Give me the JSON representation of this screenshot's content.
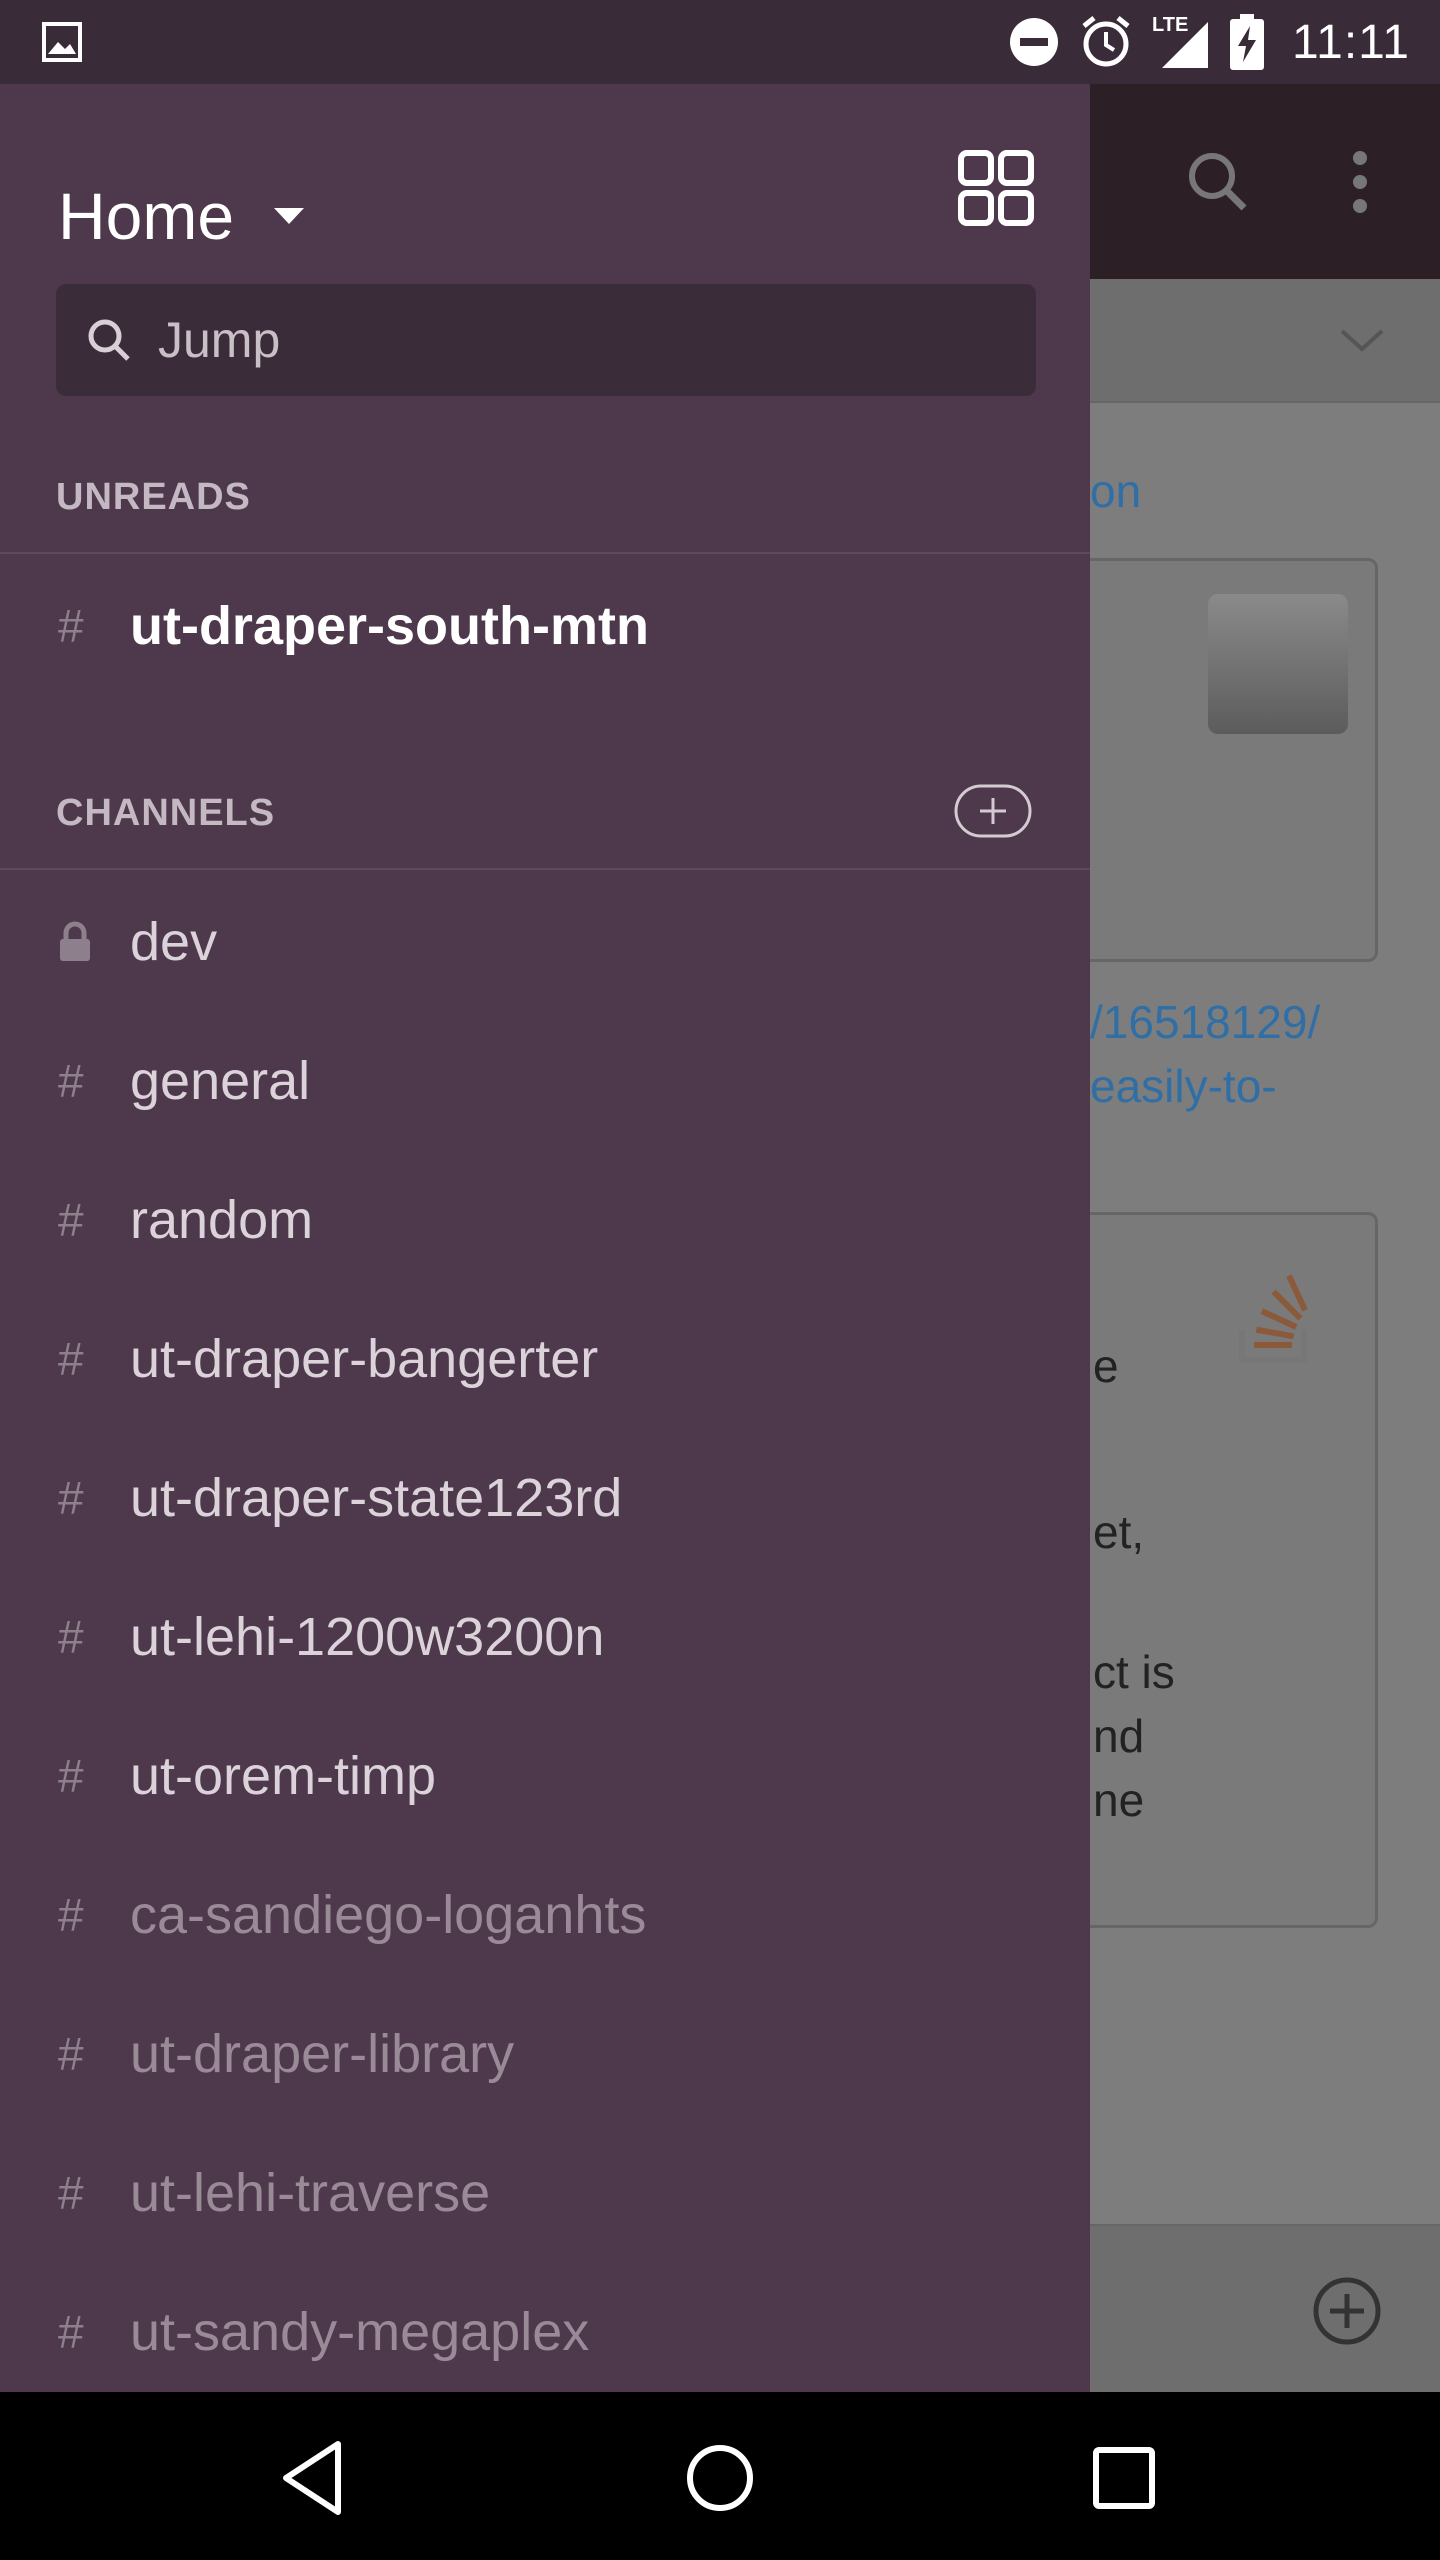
{
  "status_bar": {
    "left_icon": "image-icon",
    "icons": [
      "dnd-icon",
      "alarm-icon",
      "signal-lte-icon",
      "battery-charging-icon"
    ],
    "network": "LTE",
    "time": "11:11"
  },
  "drawer": {
    "title": "Home",
    "jump_placeholder": "Jump",
    "unreads_header": "UNREADS",
    "unreads": [
      {
        "name": "ut-draper-south-mtn",
        "icon": "#"
      }
    ],
    "channels_header": "CHANNELS",
    "channels": [
      {
        "name": "dev",
        "icon": "lock"
      },
      {
        "name": "general",
        "icon": "#"
      },
      {
        "name": "random",
        "icon": "#"
      },
      {
        "name": "ut-draper-bangerter",
        "icon": "#"
      },
      {
        "name": "ut-draper-state123rd",
        "icon": "#"
      },
      {
        "name": "ut-lehi-1200w3200n",
        "icon": "#"
      },
      {
        "name": "ut-orem-timp",
        "icon": "#"
      },
      {
        "name": "ca-sandiego-loganhts",
        "icon": "#"
      },
      {
        "name": "ut-draper-library",
        "icon": "#"
      },
      {
        "name": "ut-lehi-traverse",
        "icon": "#"
      },
      {
        "name": "ut-sandy-megaplex",
        "icon": "#"
      }
    ]
  },
  "background": {
    "link_fragment": "on",
    "url_line1": "/16518129/",
    "url_line2": "easily-to-",
    "card_lines": [
      "e",
      "et,",
      "ct is",
      "nd",
      "ne"
    ]
  },
  "colors": {
    "drawer_bg": "#4d394b",
    "status_bar_bg": "#3a2b38",
    "search_bg": "#3b2c39",
    "link": "#2f6fa6"
  }
}
